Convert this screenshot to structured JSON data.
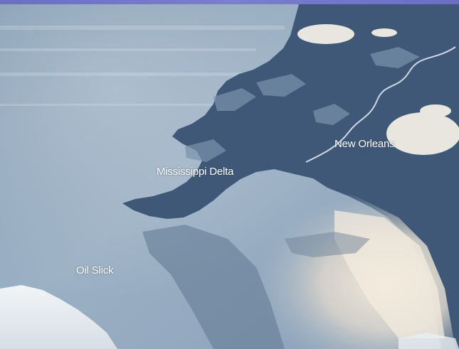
{
  "image": {
    "subject": "satellite-image",
    "colors": {
      "frame_top": "#6b6fc4",
      "sea_haze": "#8fa7bd",
      "land_dark": "#3f5877",
      "sunglint": "#efe6d6"
    }
  },
  "labels": {
    "delta": "Mississippi Delta",
    "city": "New Orleans",
    "slick": "Oil Slick"
  }
}
